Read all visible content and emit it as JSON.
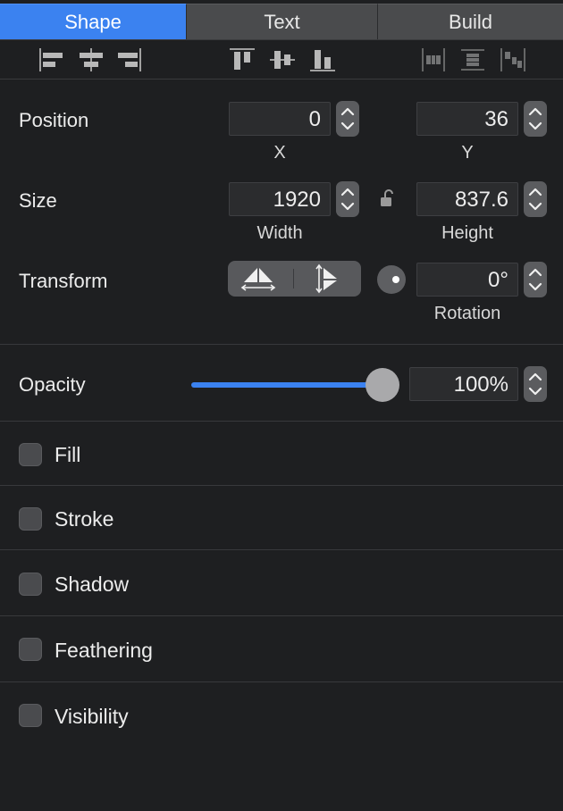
{
  "tabs": [
    {
      "label": "Shape",
      "active": true
    },
    {
      "label": "Text",
      "active": false
    },
    {
      "label": "Build",
      "active": false
    }
  ],
  "alignment_icons": [
    "align-left-icon",
    "align-center-icon",
    "align-right-icon",
    "align-top-icon",
    "align-middle-icon",
    "align-bottom-icon",
    "distribute-horizontal-icon",
    "distribute-vertical-icon",
    "distribute-spacing-icon"
  ],
  "position": {
    "label": "Position",
    "x": "0",
    "x_label": "X",
    "y": "36",
    "y_label": "Y"
  },
  "size": {
    "label": "Size",
    "width": "1920",
    "width_label": "Width",
    "height": "837.6",
    "height_label": "Height",
    "lock_icon": "unlocked-lock-icon"
  },
  "transform": {
    "label": "Transform",
    "flip_horizontal_icon": "flip-horizontal-icon",
    "flip_vertical_icon": "flip-vertical-icon",
    "rotation": "0°",
    "rotation_label": "Rotation"
  },
  "opacity": {
    "label": "Opacity",
    "value": "100%",
    "level": 1.0
  },
  "sections": [
    {
      "label": "Fill",
      "checked": false
    },
    {
      "label": "Stroke",
      "checked": false
    },
    {
      "label": "Shadow",
      "checked": false
    },
    {
      "label": "Feathering",
      "checked": false
    },
    {
      "label": "Visibility",
      "checked": false
    }
  ],
  "colors": {
    "accent": "#3b82f0",
    "background": "#1e1f21",
    "field": "#2b2c2e",
    "control": "#5b5c5f"
  }
}
